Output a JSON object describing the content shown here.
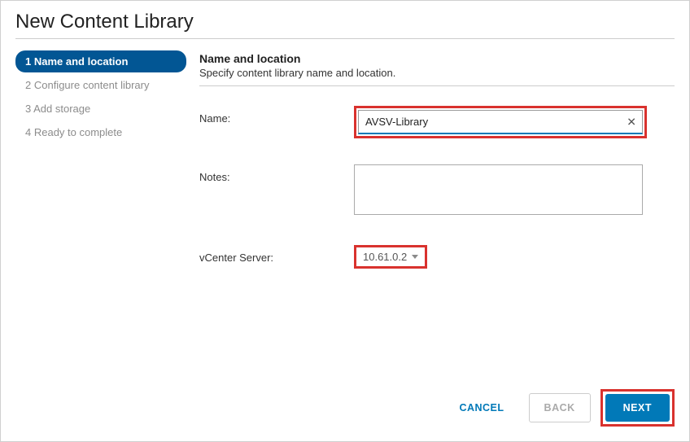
{
  "dialog": {
    "title": "New Content Library"
  },
  "steps": [
    {
      "label": "1 Name and location",
      "active": true
    },
    {
      "label": "2 Configure content library",
      "active": false
    },
    {
      "label": "3 Add storage",
      "active": false
    },
    {
      "label": "4 Ready to complete",
      "active": false
    }
  ],
  "section": {
    "title": "Name and location",
    "subtitle": "Specify content library name and location."
  },
  "form": {
    "name_label": "Name:",
    "name_value": "AVSV-Library",
    "notes_label": "Notes:",
    "notes_value": "",
    "vcenter_label": "vCenter Server:",
    "vcenter_value": "10.61.0.2"
  },
  "buttons": {
    "cancel": "CANCEL",
    "back": "BACK",
    "next": "NEXT"
  }
}
